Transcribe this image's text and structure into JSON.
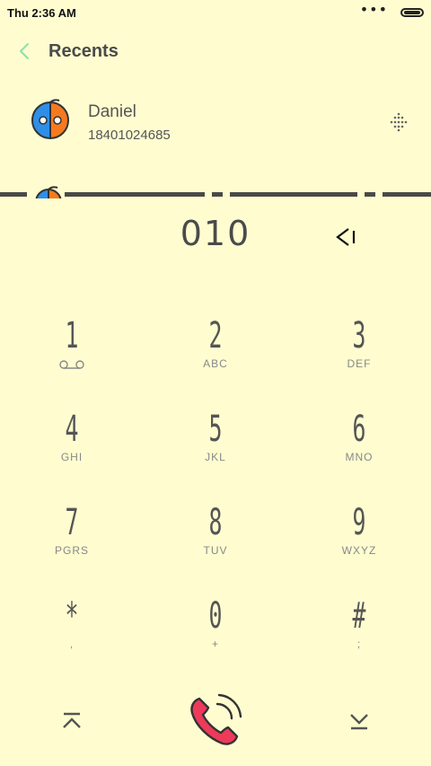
{
  "status_bar": {
    "time": "Thu 2:36 AM",
    "menu_dots": "•••"
  },
  "header": {
    "title": "Recents",
    "back_icon": "chevron-left-icon"
  },
  "recent_contact": {
    "name": "Daniel",
    "number": "18401024685",
    "avatar_icon": "face-avatar-icon",
    "action_icon": "dialpad-grid-icon"
  },
  "dialer": {
    "entered_number": "010",
    "backspace_icon": "backspace-icon"
  },
  "keypad": [
    {
      "digit": "1",
      "letters": ""
    },
    {
      "digit": "2",
      "letters": "ABC"
    },
    {
      "digit": "3",
      "letters": "DEF"
    },
    {
      "digit": "4",
      "letters": "GHI"
    },
    {
      "digit": "5",
      "letters": "JKL"
    },
    {
      "digit": "6",
      "letters": "MNO"
    },
    {
      "digit": "7",
      "letters": "PGRS"
    },
    {
      "digit": "8",
      "letters": "TUV"
    },
    {
      "digit": "9",
      "letters": "WXYZ"
    },
    {
      "digit": "*",
      "letters": ","
    },
    {
      "digit": "0",
      "letters": "+"
    },
    {
      "digit": "#",
      "letters": ";"
    }
  ],
  "bottom_bar": {
    "collapse_icon": "collapse-up-icon",
    "call_icon": "phone-call-icon",
    "expand_icon": "expand-down-icon"
  },
  "colors": {
    "background": "#FFFDD0",
    "accent_green": "#8EE0A6",
    "avatar_blue": "#2F8FE8",
    "avatar_orange": "#F57A1F",
    "call_red": "#EE3A5A",
    "text_dark": "#4A4A4A",
    "divider": "#4A4A4A"
  }
}
